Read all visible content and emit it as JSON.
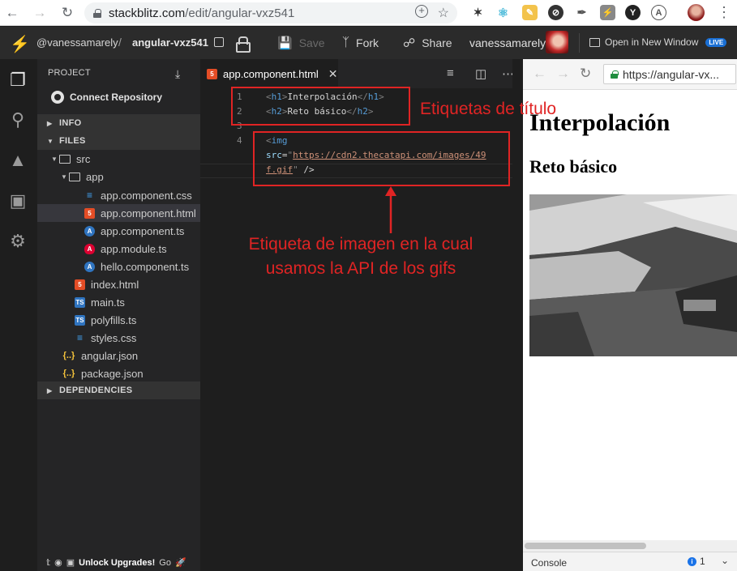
{
  "browser": {
    "url_host": "stackblitz.com",
    "url_path": "/edit/angular-vxz541",
    "extensions": [
      "ext-1",
      "react-icon",
      "ext-3",
      "ext-4",
      "ext-5",
      "ext-6",
      "ext-7",
      "ext-8",
      "ext-9"
    ]
  },
  "header": {
    "user": "@vanessamarely",
    "separator": "/",
    "project": "angular-vxz541",
    "save_label": "Save",
    "fork_label": "Fork",
    "share_label": "Share",
    "username": "vanessamarely",
    "open_window_label": "Open in New Window",
    "live_badge": "LIVE"
  },
  "sidebar": {
    "project_label": "PROJECT",
    "connect_label": "Connect Repository",
    "info_label": "INFO",
    "files_label": "FILES",
    "dependencies_label": "DEPENDENCIES",
    "tree": [
      {
        "name": "src",
        "type": "folder"
      },
      {
        "name": "app",
        "type": "folder"
      },
      {
        "name": "app.component.css",
        "type": "css"
      },
      {
        "name": "app.component.html",
        "type": "html",
        "selected": true
      },
      {
        "name": "app.component.ts",
        "type": "ngts"
      },
      {
        "name": "app.module.ts",
        "type": "ng"
      },
      {
        "name": "hello.component.ts",
        "type": "ngts"
      },
      {
        "name": "index.html",
        "type": "html"
      },
      {
        "name": "main.ts",
        "type": "ts"
      },
      {
        "name": "polyfills.ts",
        "type": "ts"
      },
      {
        "name": "styles.css",
        "type": "css"
      },
      {
        "name": "angular.json",
        "type": "json"
      },
      {
        "name": "package.json",
        "type": "json"
      }
    ],
    "footer_label": "Unlock Upgrades!",
    "footer_go": "Go"
  },
  "editor": {
    "tab_label": "app.component.html",
    "line_numbers": [
      "1",
      "2",
      "3",
      "4"
    ],
    "line1": {
      "open": "h1",
      "text": "Interpolación",
      "close": "h1"
    },
    "line2": {
      "open": "h2",
      "text": "Reto básico",
      "close": "h2"
    },
    "line4": {
      "tag": "img",
      "attr": "src",
      "url_part1": "https://cdn2.thecatapi.com/images/49",
      "url_part2": "f.gif",
      "tail": " />"
    }
  },
  "preview": {
    "url": "https://angular-vx...",
    "h1": "Interpolación",
    "h2": "Reto básico",
    "console_label": "Console",
    "console_count": "1"
  },
  "annotations": {
    "title_tags": "Etiquetas de título",
    "image_tag_line1": "Etiqueta de imagen en la cual",
    "image_tag_line2": "usamos la API de los gifs",
    "color": "#e02424"
  }
}
